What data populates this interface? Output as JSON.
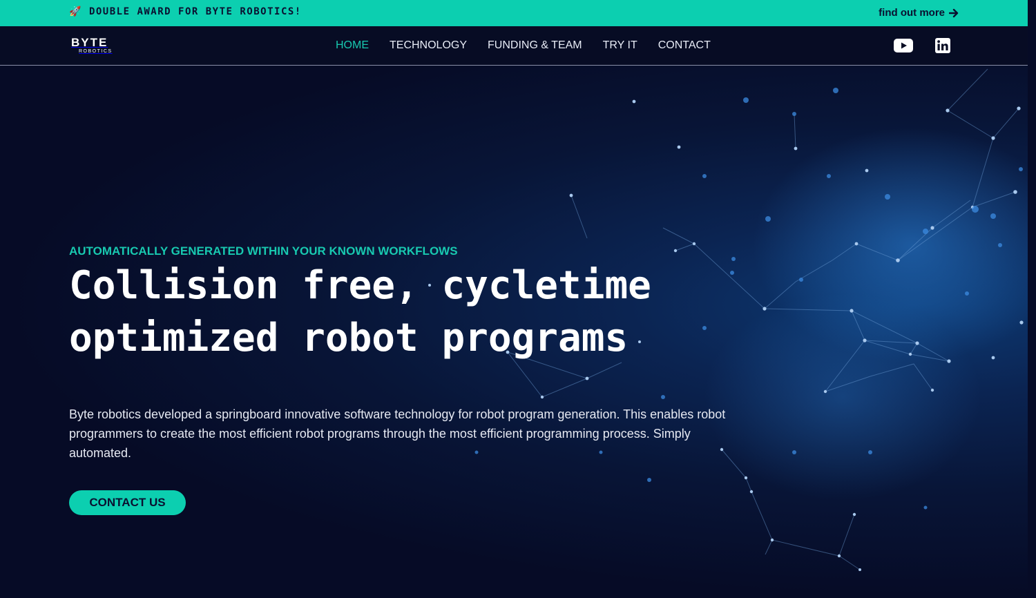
{
  "banner": {
    "announcement": "DOUBLE AWARD FOR BYTE ROBOTICS!",
    "link_label": "find out more",
    "icons": [
      "rocket-icon",
      "arrow-right-icon"
    ]
  },
  "brand": {
    "name": "BYTE",
    "subtitle": "ROBOTICS"
  },
  "nav": {
    "items": [
      {
        "label": "HOME",
        "active": true
      },
      {
        "label": "TECHNOLOGY",
        "active": false
      },
      {
        "label": "FUNDING & TEAM",
        "active": false
      },
      {
        "label": "TRY IT",
        "active": false
      },
      {
        "label": "CONTACT",
        "active": false
      }
    ]
  },
  "social": {
    "icons": [
      "youtube-icon",
      "linkedin-icon"
    ]
  },
  "hero": {
    "eyebrow": "AUTOMATICALLY GENERATED WITHIN YOUR KNOWN WORKFLOWS",
    "title": "Collision free, cycletime optimized robot programs",
    "description": "Byte robotics developed a springboard innovative software technology for robot program generation. This enables robot programmers to create the most efficient robot programs through the most efficient programming process. Simply automated.",
    "cta_label": "CONTACT US"
  },
  "colors": {
    "accent": "#0ccfb0",
    "background": "#060b26",
    "nav_active": "#18c9b0"
  }
}
